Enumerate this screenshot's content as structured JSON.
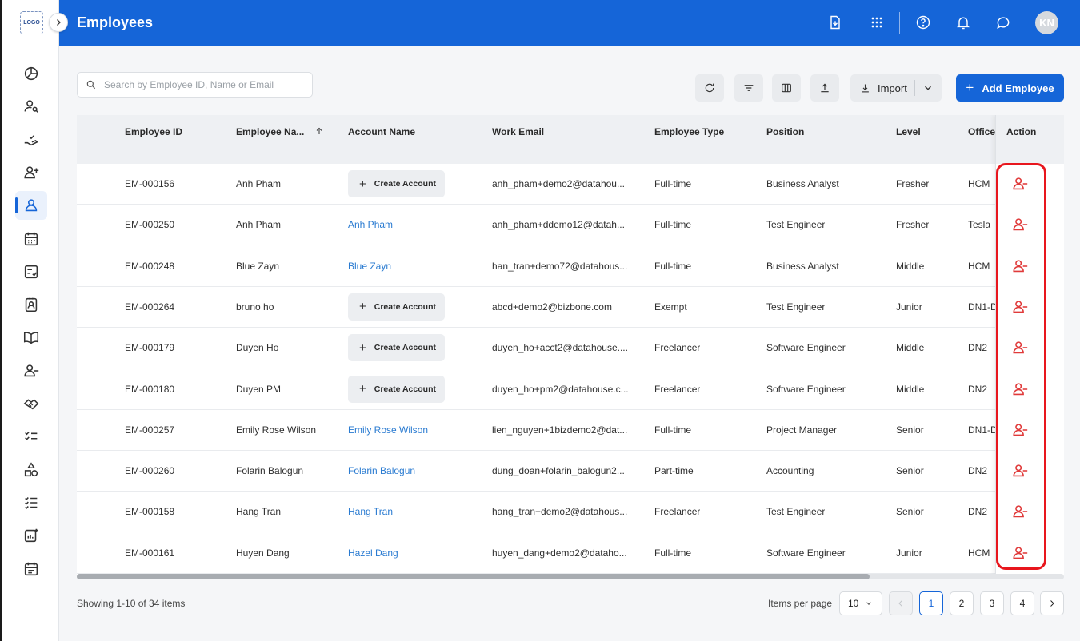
{
  "app": {
    "logo_text": "LOGO",
    "page_title": "Employees",
    "avatar_initials": "KN"
  },
  "sidebar": {
    "active_index": 4
  },
  "toolbar": {
    "search_placeholder": "Search by Employee ID, Name or Email",
    "import_label": "Import",
    "add_employee_label": "Add Employee"
  },
  "table": {
    "columns": [
      "Employee ID",
      "Employee Na...",
      "Account Name",
      "Work Email",
      "Employee Type",
      "Position",
      "Level",
      "Office",
      "Action"
    ],
    "create_account_label": "Create Account",
    "rows": [
      {
        "id": "EM-000156",
        "name": "Anh Pham",
        "account": "",
        "email": "anh_pham+demo2@datahou...",
        "type": "Full-time",
        "position": "Business Analyst",
        "level": "Fresher",
        "office": "HCM"
      },
      {
        "id": "EM-000250",
        "name": "Anh Pham",
        "account": "Anh Pham",
        "email": "anh_pham+ddemo12@datah...",
        "type": "Full-time",
        "position": "Test Engineer",
        "level": "Fresher",
        "office": "Tesla"
      },
      {
        "id": "EM-000248",
        "name": "Blue Zayn",
        "account": "Blue Zayn",
        "email": "han_tran+demo72@datahous...",
        "type": "Full-time",
        "position": "Business Analyst",
        "level": "Middle",
        "office": "HCM"
      },
      {
        "id": "EM-000264",
        "name": "bruno ho",
        "account": "",
        "email": "abcd+demo2@bizbone.com",
        "type": "Exempt",
        "position": "Test Engineer",
        "level": "Junior",
        "office": "DN1-D"
      },
      {
        "id": "EM-000179",
        "name": "Duyen Ho",
        "account": "",
        "email": "duyen_ho+acct2@datahouse....",
        "type": "Freelancer",
        "position": "Software Engineer",
        "level": "Middle",
        "office": "DN2"
      },
      {
        "id": "EM-000180",
        "name": "Duyen PM",
        "account": "",
        "email": "duyen_ho+pm2@datahouse.c...",
        "type": "Freelancer",
        "position": "Software Engineer",
        "level": "Middle",
        "office": "DN2"
      },
      {
        "id": "EM-000257",
        "name": "Emily Rose Wilson",
        "account": "Emily Rose Wilson",
        "email": "lien_nguyen+1bizdemo2@dat...",
        "type": "Full-time",
        "position": "Project Manager",
        "level": "Senior",
        "office": "DN1-D"
      },
      {
        "id": "EM-000260",
        "name": "Folarin Balogun",
        "account": "Folarin Balogun",
        "email": "dung_doan+folarin_balogun2...",
        "type": "Part-time",
        "position": "Accounting",
        "level": "Senior",
        "office": "DN2"
      },
      {
        "id": "EM-000158",
        "name": "Hang Tran",
        "account": "Hang Tran",
        "email": "hang_tran+demo2@datahous...",
        "type": "Freelancer",
        "position": "Test Engineer",
        "level": "Senior",
        "office": "DN2"
      },
      {
        "id": "EM-000161",
        "name": "Huyen Dang",
        "account": "Hazel Dang",
        "email": "huyen_dang+demo2@dataho...",
        "type": "Full-time",
        "position": "Software Engineer",
        "level": "Junior",
        "office": "HCM"
      }
    ]
  },
  "footer": {
    "showing": "Showing 1-10 of 34 items",
    "items_per_page_label": "Items per page",
    "items_per_page": "10",
    "pages": [
      "1",
      "2",
      "3",
      "4"
    ],
    "current_page": "1"
  },
  "colors": {
    "primary": "#1565d8",
    "danger": "#e03a3a",
    "highlight": "#e8161d",
    "link": "#2a7bd1"
  }
}
